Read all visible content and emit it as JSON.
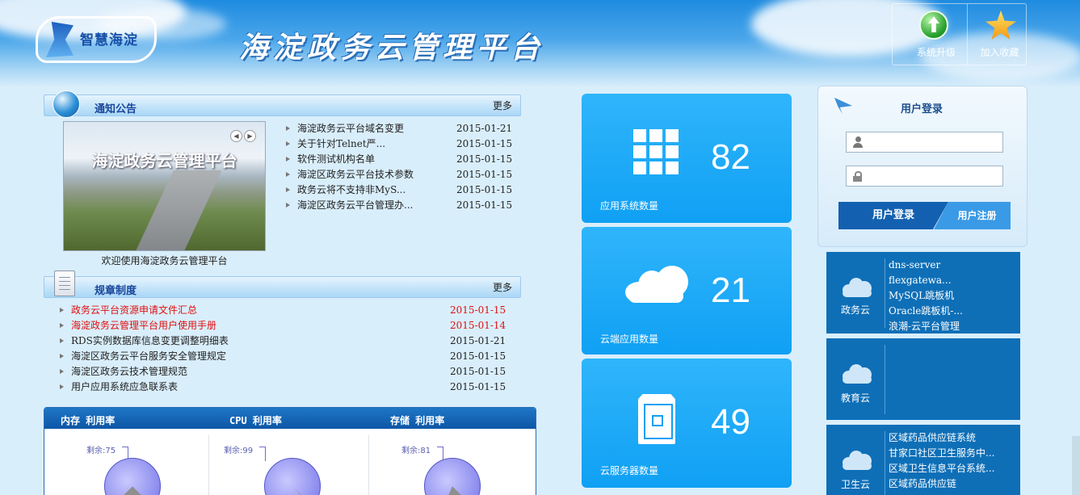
{
  "header": {
    "logo_text": "智慧海淀",
    "site_title": "海淀政务云管理平台",
    "tools": [
      {
        "label": "系统升级",
        "icon": "upgrade-arrow-icon"
      },
      {
        "label": "加入收藏",
        "icon": "star-icon"
      }
    ]
  },
  "notice": {
    "title": "通知公告",
    "more": "更多",
    "carousel_title": "海淀政务云管理平台",
    "carousel_caption": "欢迎使用海淀政务云管理平台",
    "items": [
      {
        "title": "海淀政务云平台域名变更",
        "date": "2015-01-21"
      },
      {
        "title": "关于针对Telnet严...",
        "date": "2015-01-15"
      },
      {
        "title": "软件测试机构名单",
        "date": "2015-01-15"
      },
      {
        "title": "海淀区政务云平台技术参数",
        "date": "2015-01-15"
      },
      {
        "title": "政务云将不支持非MyS...",
        "date": "2015-01-15"
      },
      {
        "title": "海淀区政务云平台管理办...",
        "date": "2015-01-15"
      }
    ]
  },
  "rules": {
    "title": "规章制度",
    "more": "更多",
    "items": [
      {
        "title": "政务云平台资源申请文件汇总",
        "date": "2015-01-15",
        "highlight": true
      },
      {
        "title": "海淀政务云管理平台用户使用手册",
        "date": "2015-01-14",
        "highlight": true
      },
      {
        "title": "RDS实例数据库信息变更调整明细表",
        "date": "2015-01-21",
        "highlight": false
      },
      {
        "title": "海淀区政务云平台服务安全管理规定",
        "date": "2015-01-15",
        "highlight": false
      },
      {
        "title": "海淀区政务云技术管理规范",
        "date": "2015-01-15",
        "highlight": false
      },
      {
        "title": "用户应用系统应急联系表",
        "date": "2015-01-15",
        "highlight": false
      }
    ]
  },
  "usage": {
    "memory": {
      "label": "内存 利用率",
      "remain_text": "剩余:75",
      "remain_percent": 75
    },
    "cpu": {
      "label": "CPU 利用率",
      "remain_text": "剩余:99",
      "remain_percent": 99
    },
    "storage": {
      "label": "存储 利用率",
      "remain_text": "剩余:81",
      "remain_percent": 81
    }
  },
  "tiles": {
    "apps": {
      "value": "82",
      "label": "应用系统数量",
      "icon": "grid-icon"
    },
    "cloud_apps": {
      "value": "21",
      "label": "云端应用数量",
      "icon": "cloud-icon"
    },
    "servers": {
      "value": "49",
      "label": "云服务器数量",
      "icon": "server-icon"
    }
  },
  "login": {
    "title": "用户登录",
    "username_value": "",
    "password_value": "",
    "login_button": "用户登录",
    "register_button": "用户注册"
  },
  "categories": {
    "gov": {
      "name": "政务云",
      "items": [
        "dns-server",
        "flexgatewa...",
        "MySQL跳板机",
        "Oracle跳板机-...",
        "浪潮-云平台管理"
      ]
    },
    "edu": {
      "name": "教育云",
      "items": []
    },
    "health": {
      "name": "卫生云",
      "items": [
        "区域药品供应链系统",
        "甘家口社区卫生服务中...",
        "区域卫生信息平台系统...",
        "区域药品供应链"
      ]
    }
  },
  "colors": {
    "header_blue": "#1f8be0",
    "tile_blue": "#10a0f4",
    "category_blue": "#0e6fb7",
    "highlight_red": "#e01010",
    "section_title": "#18469b"
  }
}
